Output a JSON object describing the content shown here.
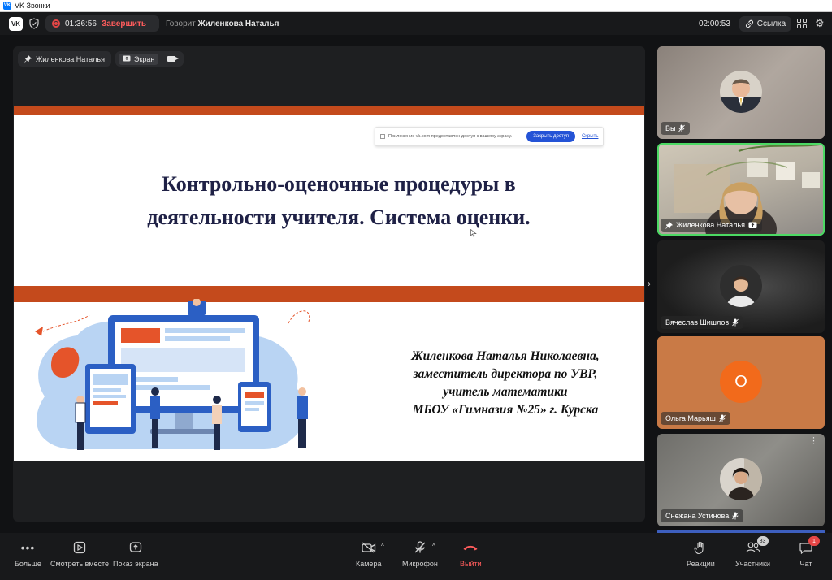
{
  "window": {
    "title": "VK Звонки"
  },
  "header": {
    "logo": "VK",
    "recording_time": "01:36:56",
    "end_label": "Завершить",
    "speaking_prefix": "Говорит",
    "speaking_name": "Жиленкова Наталья",
    "elapsed": "02:00:53",
    "link_label": "Ссылка"
  },
  "stage": {
    "pinned_name": "Жиленкова Наталья",
    "screen_label": "Экран"
  },
  "slide": {
    "banner_text": "Приложение vk.com предоставлен доступ к вашему экрану.",
    "banner_close": "Закрыть доступ",
    "banner_hide": "Скрыть",
    "title_line1": "Контрольно-оценочные процедуры в",
    "title_line2": "деятельности учителя. Система оценки.",
    "author_line1": "Жиленкова Наталья Николаевна,",
    "author_line2": "заместитель директора по УВР,",
    "author_line3": "учитель математики",
    "author_line4": "МБОУ «Гимназия №25» г. Курска"
  },
  "participants": [
    {
      "name": "Вы",
      "mic": "off",
      "pinned": false
    },
    {
      "name": "Жиленкова Наталья",
      "mic": "on",
      "pinned": true,
      "sharing": true
    },
    {
      "name": "Вячеслав Шишлов",
      "mic": "off",
      "pinned": false
    },
    {
      "name": "Ольга Марьяш",
      "mic": "off",
      "pinned": false,
      "initial": "О"
    },
    {
      "name": "Снежана Устинова",
      "mic": "off",
      "pinned": false
    }
  ],
  "toolbar": {
    "more": "Больше",
    "watch_together": "Смотреть вместе",
    "screen_share": "Показ экрана",
    "camera": "Камера",
    "microphone": "Микрофон",
    "leave": "Выйти",
    "reactions": "Реакции",
    "participants": "Участники",
    "participants_count": "83",
    "chat": "Чат",
    "chat_badge": "1"
  },
  "colors": {
    "accent_red": "#ff5c5c",
    "active_border": "#4cd964",
    "slide_bar": "#c44a1c",
    "olga_avatar": "#f26a1b",
    "badge_red": "#e64646"
  }
}
